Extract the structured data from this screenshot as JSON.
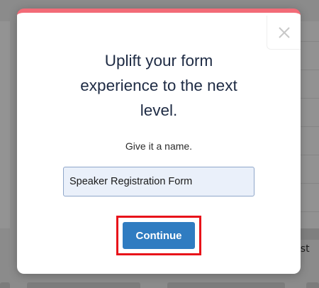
{
  "modal": {
    "title_line1": "Uplift your form",
    "title_line2": "experience to the next",
    "title_line3": "level.",
    "subtitle": "Give it a name.",
    "name_value": "Speaker Registration Form",
    "continue_label": "Continue",
    "accent_color": "#f26b77",
    "button_color": "#2f7cc1",
    "highlight_color": "#e8131a"
  },
  "background": {
    "partial_text": "gist"
  },
  "icons": {
    "close": "close-icon"
  }
}
